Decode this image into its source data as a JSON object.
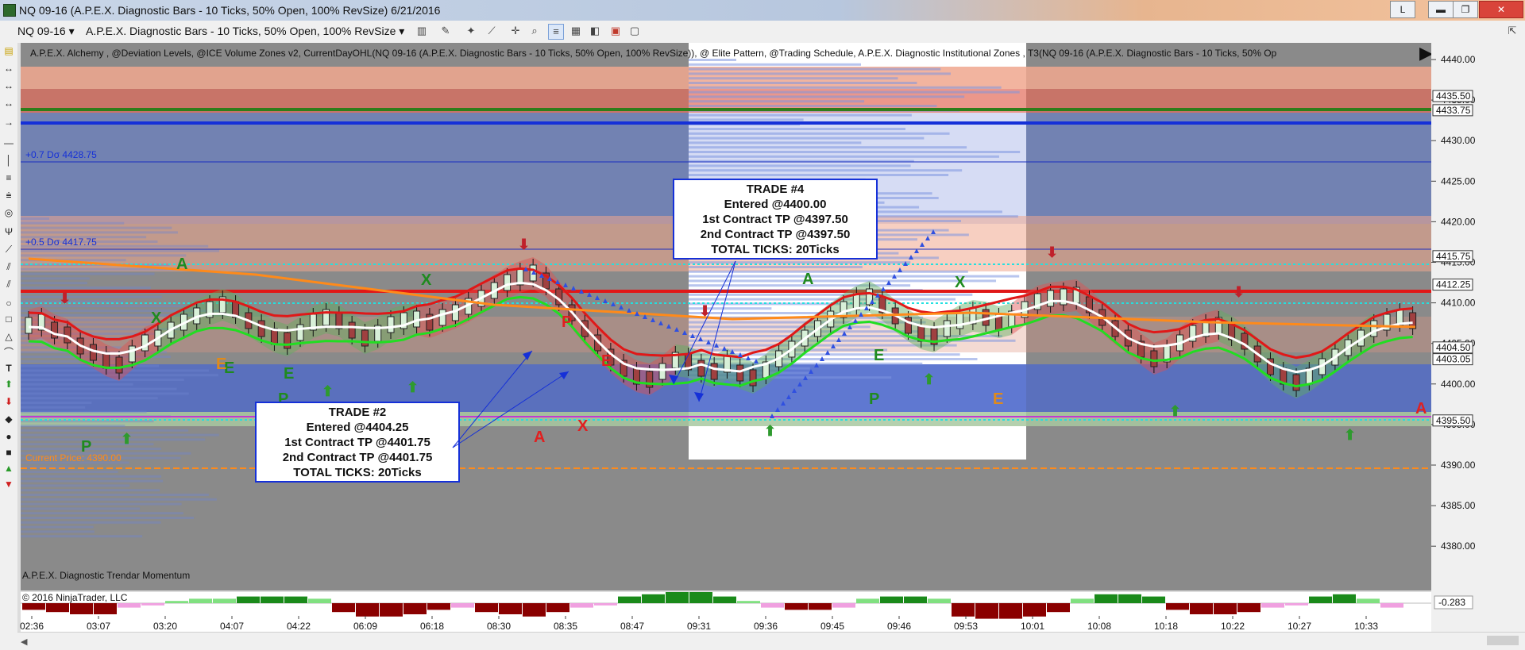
{
  "window": {
    "title": "NQ 09-16 (A.P.E.X. Diagnostic Bars - 10 Ticks, 50% Open, 100% RevSize)  6/21/2016",
    "buttons": {
      "l": "L",
      "minimize": "▬",
      "restore": "❐",
      "close": "✕"
    }
  },
  "toolbar": {
    "instrument": "NQ 09-16",
    "bar_type": "A.P.E.X. Diagnostic Bars - 10 Ticks, 50% Open, 100% RevSize",
    "icons": [
      "bar-style-icon",
      "pencil-icon",
      "magic-wand-icon",
      "crosshair-icon",
      "zoom-icon",
      "properties-icon",
      "data-box-icon",
      "strategies-icon",
      "alerts-icon"
    ]
  },
  "chart": {
    "indicator_label": "A.P.E.X. Alchemy , @Deviation Levels, @ICE Volume Zones v2, CurrentDayOHL(NQ 09-16 (A.P.E.X. Diagnostic Bars - 10 Ticks, 50% Open, 100% RevSize)), @ Elite Pattern, @Trading Schedule, A.P.E.X. Diagnostic Institutional Zones , T3(NQ 09-16 (A.P.E.X. Diagnostic Bars - 10 Ticks, 50% Op",
    "deviation_labels": [
      "+0.7 Dσ 4428.75",
      "+0.5 Dσ 4417.75"
    ],
    "current_price_label": "Current Price: 4390.00",
    "sub_panel_label": "A.P.E.X. Diagnostic Trendar Momentum",
    "copyright": "© 2016 NinjaTrader, LLC",
    "price_axis": [
      "4440.00",
      "4435.00",
      "4430.00",
      "4425.00",
      "4420.00",
      "4415.00",
      "4410.00",
      "4405.00",
      "4400.00",
      "4395.00",
      "4390.00",
      "4385.00",
      "4380.00"
    ],
    "price_markers": [
      {
        "label": "4435.50",
        "color": "#ffffff"
      },
      {
        "label": "4433.75",
        "color": "#ffffff"
      },
      {
        "label": "4415.75",
        "color": "#ffffff"
      },
      {
        "label": "4412.25",
        "color": "#ffffff"
      },
      {
        "label": "4404.50",
        "color": "#ffffff"
      },
      {
        "label": "4403.05",
        "color": "#ffffff"
      },
      {
        "label": "4395.50",
        "color": "#ffffff"
      }
    ],
    "momentum_value": "-0.283",
    "time_axis": [
      "02:36",
      "03:07",
      "03:20",
      "04:07",
      "04:22",
      "06:09",
      "06:18",
      "08:30",
      "08:35",
      "08:47",
      "09:31",
      "09:36",
      "09:45",
      "09:46",
      "09:53",
      "10:01",
      "10:08",
      "10:18",
      "10:22",
      "10:27",
      "10:33"
    ],
    "trade2": {
      "lines": [
        "TRADE #2",
        "Entered @4404.25",
        "1st Contract TP @4401.75",
        "2nd Contract TP @4401.75",
        "TOTAL TICKS: 20Ticks"
      ]
    },
    "trade4": {
      "lines": [
        "TRADE #4",
        "Entered @4400.00",
        "1st Contract TP @4397.50",
        "2nd Contract TP @4397.50",
        "TOTAL TICKS: 20Ticks"
      ]
    },
    "pattern_letters": [
      {
        "t": "A",
        "c": "#1f8a1f"
      },
      {
        "t": "X",
        "c": "#1f8a1f"
      },
      {
        "t": "X",
        "c": "#1f8a1f"
      },
      {
        "t": "E",
        "c": "#1f8a1f"
      },
      {
        "t": "E",
        "c": "#1f8a1f"
      },
      {
        "t": "P",
        "c": "#1f8a1f"
      },
      {
        "t": "P",
        "c": "#1f8a1f"
      },
      {
        "t": "E",
        "c": "#e08a1a"
      },
      {
        "t": "A",
        "c": "#e02020"
      },
      {
        "t": "P",
        "c": "#e02020"
      },
      {
        "t": "E",
        "c": "#e02020"
      },
      {
        "t": "X",
        "c": "#e02020"
      },
      {
        "t": "A",
        "c": "#1f8a1f"
      },
      {
        "t": "E",
        "c": "#1f8a1f"
      },
      {
        "t": "P",
        "c": "#1f8a1f"
      },
      {
        "t": "X",
        "c": "#1f8a1f"
      },
      {
        "t": "E",
        "c": "#e08a1a"
      },
      {
        "t": "A",
        "c": "#e02020"
      }
    ],
    "colors": {
      "bg_gray": "#8a8a8a",
      "blue_zone": "#5a6fb0",
      "salmon_zone": "#f0a78e",
      "green_line": "#2e7d1a",
      "blue_line": "#1530d8",
      "red_level": "#e01818",
      "cyan_dotted": "#22e0e0",
      "orange_dashed": "#ff8a1a"
    }
  }
}
